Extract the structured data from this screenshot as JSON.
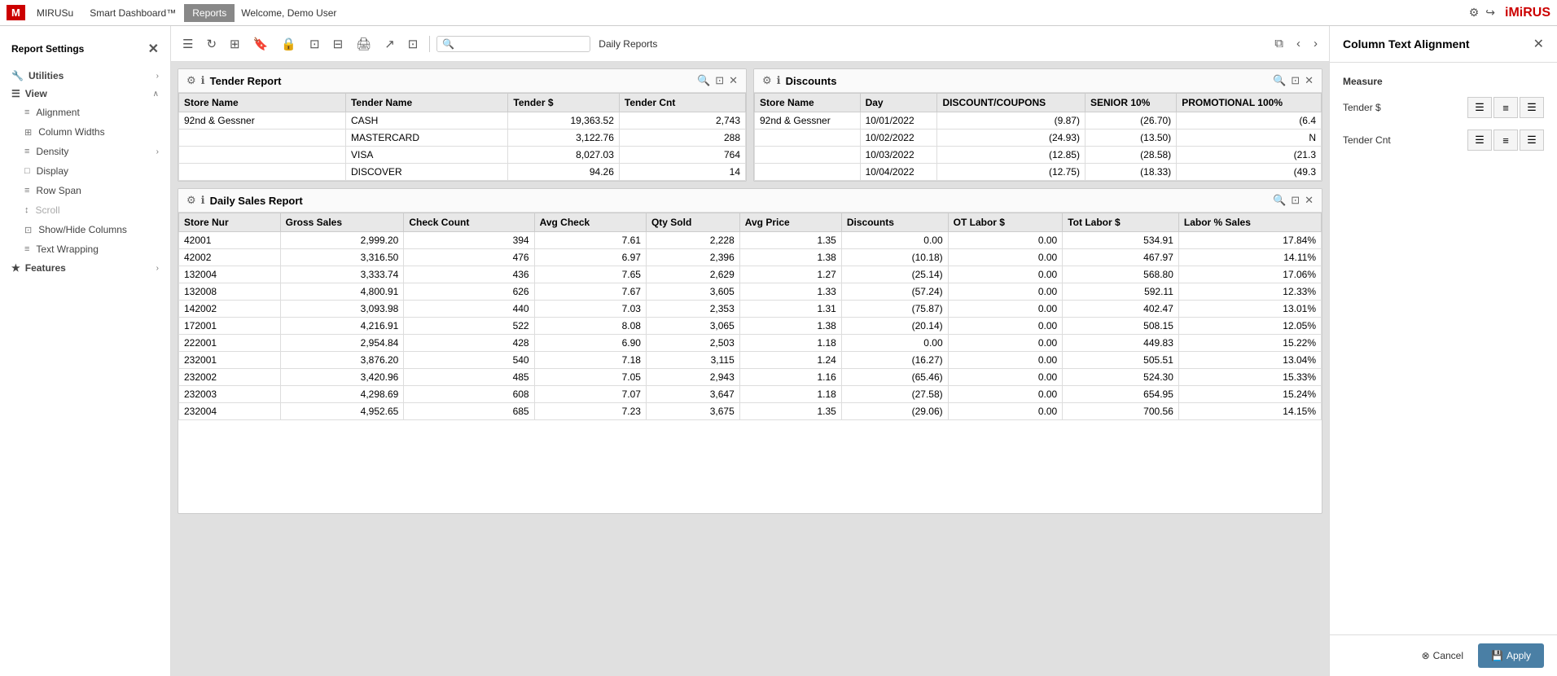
{
  "navbar": {
    "logo": "M",
    "tabs": [
      {
        "label": "MIRUSu",
        "active": false
      },
      {
        "label": "Smart Dashboard™",
        "active": false
      },
      {
        "label": "Reports",
        "active": true
      }
    ],
    "welcome": "Welcome, Demo User",
    "mirusu_logo": "iMiRUS"
  },
  "sidebar": {
    "title": "Report Settings",
    "sections": [
      {
        "label": "Utilities",
        "icon": "🔧",
        "expanded": false,
        "items": []
      },
      {
        "label": "View",
        "icon": "☰",
        "expanded": true,
        "items": [
          {
            "label": "Alignment",
            "icon": "≡"
          },
          {
            "label": "Column Widths",
            "icon": "⊞"
          },
          {
            "label": "Density",
            "icon": "≡",
            "hasChevron": true
          },
          {
            "label": "Display",
            "icon": "□"
          },
          {
            "label": "Row Span",
            "icon": "≡"
          },
          {
            "label": "Scroll",
            "icon": "↕",
            "disabled": true
          },
          {
            "label": "Show/Hide Columns",
            "icon": "⊡"
          },
          {
            "label": "Text Wrapping",
            "icon": "≡"
          }
        ]
      },
      {
        "label": "Features",
        "icon": "★",
        "expanded": false,
        "items": []
      }
    ]
  },
  "toolbar": {
    "search_placeholder": "",
    "daily_reports_label": "Daily Reports"
  },
  "tender_report": {
    "title": "Tender Report",
    "columns": [
      "Store Name",
      "Tender Name",
      "Tender $",
      "Tender Cnt"
    ],
    "rows": [
      [
        "92nd & Gessner",
        "CASH",
        "19,363.52",
        "2,743"
      ],
      [
        "",
        "MASTERCARD",
        "3,122.76",
        "288"
      ],
      [
        "",
        "VISA",
        "8,027.03",
        "764"
      ],
      [
        "",
        "DISCOVER",
        "94.26",
        "14"
      ]
    ]
  },
  "discounts_report": {
    "title": "Discounts",
    "columns": [
      "Store Name",
      "Day",
      "DISCOUNT/COUPONS",
      "SENIOR 10%",
      "PROMOTIONAL 100%"
    ],
    "rows": [
      [
        "92nd & Gessner",
        "10/01/2022",
        "(9.87)",
        "(26.70)",
        "(6.4"
      ],
      [
        "",
        "10/02/2022",
        "(24.93)",
        "(13.50)",
        "N"
      ],
      [
        "",
        "10/03/2022",
        "(12.85)",
        "(28.58)",
        "(21.3"
      ],
      [
        "",
        "10/04/2022",
        "(12.75)",
        "(18.33)",
        "(49.3"
      ]
    ]
  },
  "daily_sales_report": {
    "title": "Daily Sales Report",
    "columns": [
      "Store Nur",
      "Gross Sales",
      "Check Count",
      "Avg Check",
      "Qty Sold",
      "Avg Price",
      "Discounts",
      "OT Labor $",
      "Tot Labor $",
      "Labor % Sales"
    ],
    "rows": [
      [
        "42001",
        "2,999.20",
        "394",
        "7.61",
        "2,228",
        "1.35",
        "0.00",
        "0.00",
        "534.91",
        "17.84%"
      ],
      [
        "42002",
        "3,316.50",
        "476",
        "6.97",
        "2,396",
        "1.38",
        "(10.18)",
        "0.00",
        "467.97",
        "14.11%"
      ],
      [
        "132004",
        "3,333.74",
        "436",
        "7.65",
        "2,629",
        "1.27",
        "(25.14)",
        "0.00",
        "568.80",
        "17.06%"
      ],
      [
        "132008",
        "4,800.91",
        "626",
        "7.67",
        "3,605",
        "1.33",
        "(57.24)",
        "0.00",
        "592.11",
        "12.33%"
      ],
      [
        "142002",
        "3,093.98",
        "440",
        "7.03",
        "2,353",
        "1.31",
        "(75.87)",
        "0.00",
        "402.47",
        "13.01%"
      ],
      [
        "172001",
        "4,216.91",
        "522",
        "8.08",
        "3,065",
        "1.38",
        "(20.14)",
        "0.00",
        "508.15",
        "12.05%"
      ],
      [
        "222001",
        "2,954.84",
        "428",
        "6.90",
        "2,503",
        "1.18",
        "0.00",
        "0.00",
        "449.83",
        "15.22%"
      ],
      [
        "232001",
        "3,876.20",
        "540",
        "7.18",
        "3,115",
        "1.24",
        "(16.27)",
        "0.00",
        "505.51",
        "13.04%"
      ],
      [
        "232002",
        "3,420.96",
        "485",
        "7.05",
        "2,943",
        "1.16",
        "(65.46)",
        "0.00",
        "524.30",
        "15.33%"
      ],
      [
        "232003",
        "4,298.69",
        "608",
        "7.07",
        "3,647",
        "1.18",
        "(27.58)",
        "0.00",
        "654.95",
        "15.24%"
      ],
      [
        "232004",
        "4,952.65",
        "685",
        "7.23",
        "3,675",
        "1.35",
        "(29.06)",
        "0.00",
        "700.56",
        "14.15%"
      ]
    ]
  },
  "column_text_alignment": {
    "title": "Column Text Alignment",
    "measure_label": "Measure",
    "measures": [
      {
        "name": "Tender $",
        "alignment": "left",
        "options": [
          "left",
          "center",
          "right"
        ]
      },
      {
        "name": "Tender Cnt",
        "alignment": "left",
        "options": [
          "left",
          "center",
          "right"
        ]
      }
    ],
    "cancel_label": "Cancel",
    "apply_label": "Apply"
  }
}
